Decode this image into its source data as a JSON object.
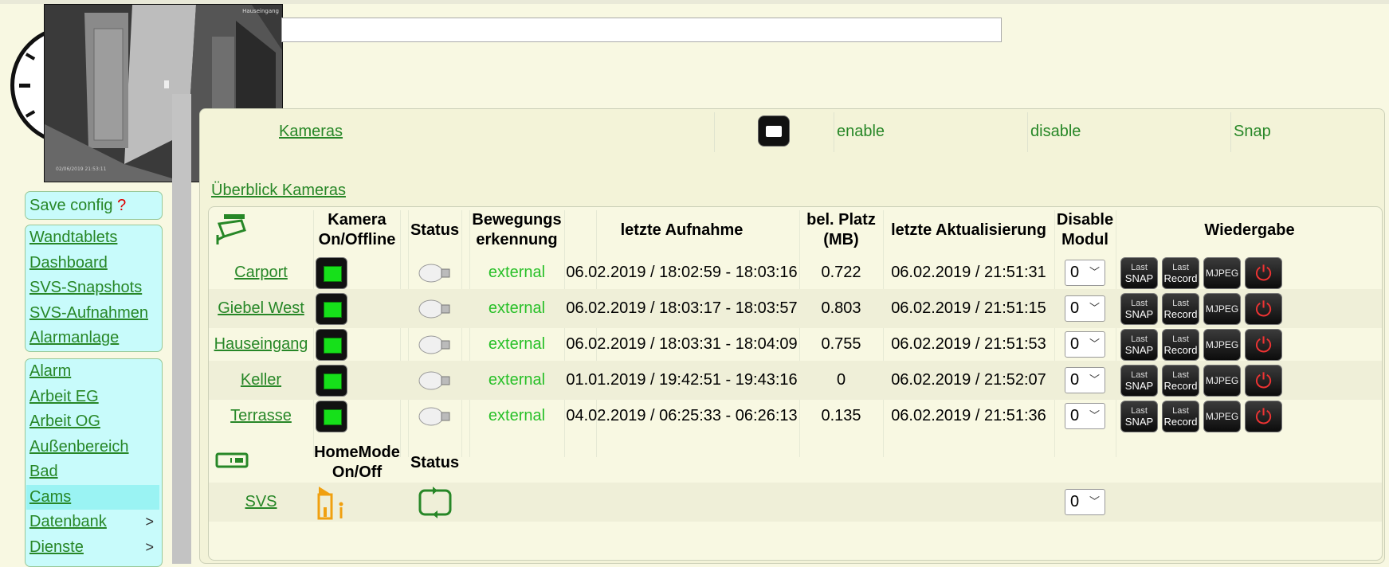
{
  "camera_preview": {
    "label": "Hauseingang",
    "timestamp": "02/06/2019   21:53:11"
  },
  "sidebar": {
    "save_config": "Save config",
    "save_config_mark": "?",
    "group1": [
      "Wandtablets",
      "Dashboard",
      "SVS-Snapshots",
      "SVS-Aufnahmen",
      "Alarmanlage"
    ],
    "group2": [
      {
        "label": "Alarm"
      },
      {
        "label": "Arbeit EG"
      },
      {
        "label": "Arbeit OG"
      },
      {
        "label": "Außenbereich"
      },
      {
        "label": "Bad"
      },
      {
        "label": "Cams",
        "active": true
      },
      {
        "label": "Datenbank",
        "chevron": ">"
      },
      {
        "label": "Dienste",
        "chevron": ">"
      }
    ]
  },
  "toprow": {
    "kameras": "Kameras",
    "enable": "enable",
    "disable": "disable",
    "snap": "Snap"
  },
  "overview_title": "Überblick Kameras",
  "table": {
    "headers": {
      "online": "Kamera On/Offline",
      "status": "Status",
      "motion": "Bewegungs erkennung",
      "last_rec": "letzte Aufnahme",
      "space": "bel. Platz (MB)",
      "last_update": "letzte Aktualisierung",
      "disable": "Disable Modul",
      "playback": "Wiedergabe"
    },
    "rows": [
      {
        "name": "Carport",
        "motion": "external",
        "last_rec": "06.02.2019 / 18:02:59 - 18:03:16",
        "space": "0.722",
        "last_update": "06.02.2019 / 21:51:31",
        "disable": "0"
      },
      {
        "name": "Giebel West",
        "motion": "external",
        "last_rec": "06.02.2019 / 18:03:17 - 18:03:57",
        "space": "0.803",
        "last_update": "06.02.2019 / 21:51:15",
        "disable": "0"
      },
      {
        "name": "Hauseingang",
        "motion": "external",
        "last_rec": "06.02.2019 / 18:03:31 - 18:04:09",
        "space": "0.755",
        "last_update": "06.02.2019 / 21:51:53",
        "disable": "0"
      },
      {
        "name": "Keller",
        "motion": "external",
        "last_rec": "01.01.2019 / 19:42:51 - 19:43:16",
        "space": "0",
        "last_update": "06.02.2019 / 21:52:07",
        "disable": "0"
      },
      {
        "name": "Terrasse",
        "motion": "external",
        "last_rec": "04.02.2019 / 06:25:33 - 06:26:13",
        "space": "0.135",
        "last_update": "06.02.2019 / 21:51:36",
        "disable": "0"
      }
    ],
    "playback_buttons": {
      "last_snap_top": "Last",
      "last_snap_bottom": "SNAP",
      "last_record_top": "Last",
      "last_record_bottom": "Record",
      "mjpeg": "MJPEG",
      "power": "⏻"
    },
    "svs": {
      "header_homemode": "HomeMode On/Off",
      "header_status": "Status",
      "name": "SVS",
      "disable": "0"
    }
  },
  "colors": {
    "link": "#278727",
    "motion_text": "#28c028",
    "sidebar_bg": "#c8fbfb",
    "page_bg": "#f8f8e2"
  }
}
